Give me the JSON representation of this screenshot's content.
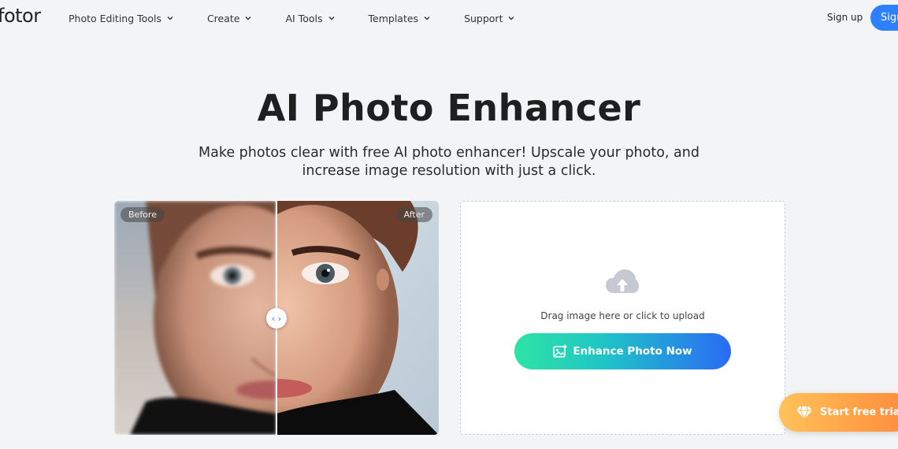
{
  "header": {
    "logo": "fotor",
    "nav": [
      {
        "label": "Photo Editing Tools"
      },
      {
        "label": "Create"
      },
      {
        "label": "AI Tools"
      },
      {
        "label": "Templates"
      },
      {
        "label": "Support"
      }
    ],
    "signup_label": "Sign up",
    "signin_label": "Sign in"
  },
  "hero": {
    "title": "AI Photo Enhancer",
    "subtitle_line1": "Make photos clear with free AI photo enhancer! Upscale your photo, and",
    "subtitle_line2": "increase image resolution with just a click."
  },
  "compare": {
    "before_label": "Before",
    "after_label": "After"
  },
  "upload": {
    "hint": "Drag image here or click to upload",
    "button_label": "Enhance Photo Now"
  },
  "floating": {
    "trial_label": "Start free trial"
  },
  "colors": {
    "accent": "#2f80ff",
    "enhance_gradient_start": "#2fe3a4",
    "enhance_gradient_end": "#2a6bf5",
    "trial_gradient_start": "#ffc35a",
    "trial_gradient_end": "#ff8a3d"
  }
}
